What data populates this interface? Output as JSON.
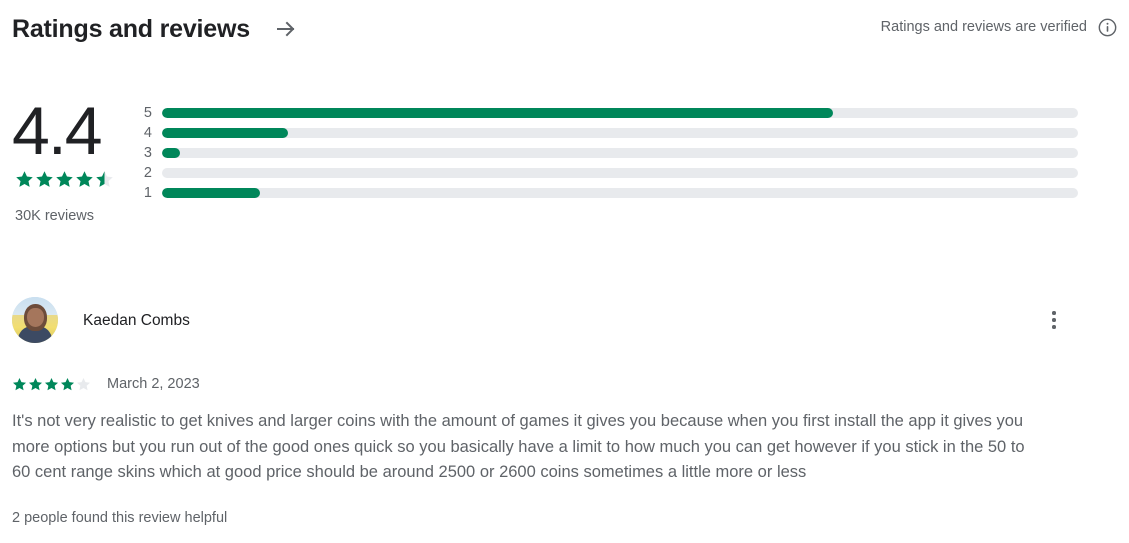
{
  "header": {
    "title": "Ratings and reviews",
    "arrow_icon": "arrow-right-icon",
    "verified_text": "Ratings and reviews are verified",
    "info_icon": "info-circle-icon"
  },
  "summary": {
    "score": "4.4",
    "stars_filled": 4.5,
    "stars_total": 5,
    "review_count": "30K reviews",
    "histogram": [
      {
        "label": "5",
        "percent": 73.3
      },
      {
        "label": "4",
        "percent": 13.8
      },
      {
        "label": "3",
        "percent": 2.0
      },
      {
        "label": "2",
        "percent": 0
      },
      {
        "label": "1",
        "percent": 10.7
      }
    ]
  },
  "review": {
    "avatar_name": "user-avatar",
    "reviewer": "Kaedan Combs",
    "more_icon": "overflow-menu-icon",
    "rating": 4,
    "rating_total": 5,
    "date": "March 2, 2023",
    "body": "It's not very realistic to get knives and larger coins with the amount of games it gives you because when you first install the app it gives you more options but you run out of the good ones quick so you basically have a limit to how much you can get however if you stick in the 50 to 60 cent range skins which at good price should be around 2500 or 2600 coins sometimes a little more or less",
    "helpful": "2 people found this review helpful"
  },
  "colors": {
    "accent_green": "#00875a",
    "track_gray": "#e8eaed",
    "text_primary": "#202124",
    "text_secondary": "#5f6368"
  }
}
